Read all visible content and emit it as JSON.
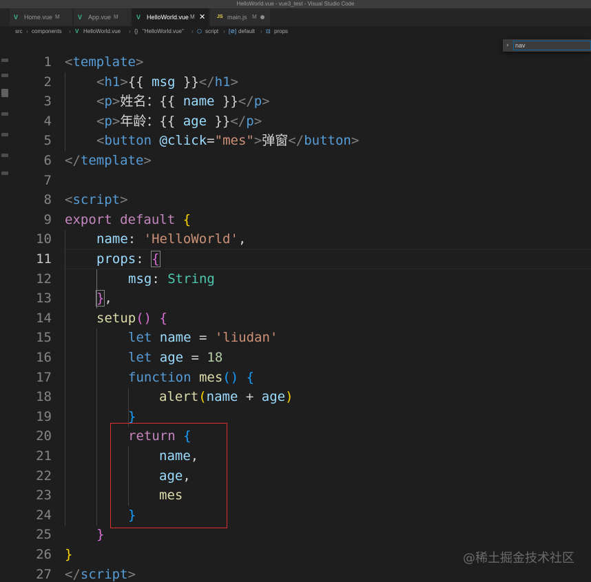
{
  "window": {
    "title": "HelloWorld.vue - vue3_test - Visual Studio Code"
  },
  "tabs": [
    {
      "icon": "V",
      "label": "Home.vue",
      "status": "M"
    },
    {
      "icon": "V",
      "label": "App.vue",
      "status": "M"
    },
    {
      "icon": "V",
      "label": "HelloWorld.vue",
      "status": "M",
      "close": "✕"
    },
    {
      "icon": "JS",
      "label": "main.js",
      "status": "M"
    }
  ],
  "breadcrumb": {
    "items": [
      "src",
      "components",
      "HelloWorld.vue",
      "\"HelloWorld.vue\"",
      "script",
      "default",
      "props"
    ],
    "separator": "›",
    "symbol_icons": [
      "V",
      "{}",
      "⬡",
      "[⊘]",
      "⊡"
    ]
  },
  "find_widget": {
    "chevron": "›",
    "value": "nav"
  },
  "editor": {
    "current_line": 11,
    "line_numbers": [
      "1",
      "2",
      "3",
      "4",
      "5",
      "6",
      "7",
      "8",
      "9",
      "10",
      "11",
      "12",
      "13",
      "14",
      "15",
      "16",
      "17",
      "18",
      "19",
      "20",
      "21",
      "22",
      "23",
      "24",
      "25",
      "26",
      "27"
    ],
    "code": {
      "l1": [
        "<",
        "template",
        ">"
      ],
      "l2": [
        "<",
        "h1",
        ">",
        "{{",
        " msg ",
        "}}",
        "</",
        "h1",
        ">"
      ],
      "l3": [
        "<",
        "p",
        ">",
        "姓名：",
        "{{",
        " name ",
        "}}",
        "</",
        "p",
        ">"
      ],
      "l4": [
        "<",
        "p",
        ">",
        "年龄：",
        "{{",
        " age ",
        "}}",
        "</",
        "p",
        ">"
      ],
      "l5": [
        "<",
        "button",
        " @click",
        "=",
        "\"mes\"",
        ">",
        "弹窗",
        "</",
        "button",
        ">"
      ],
      "l6": [
        "</",
        "template",
        ">"
      ],
      "l8": [
        "<",
        "script",
        ">"
      ],
      "l9": [
        "export",
        " default ",
        "{"
      ],
      "l10": [
        "name",
        ": ",
        "'HelloWorld'",
        ","
      ],
      "l11": [
        "props",
        ": ",
        "{"
      ],
      "l12": [
        "msg",
        ": ",
        "String"
      ],
      "l13": [
        "}",
        ","
      ],
      "l14": [
        "setup",
        "()",
        " {"
      ],
      "l15": [
        "let",
        " name",
        " = ",
        "'liudan'"
      ],
      "l16": [
        "let",
        " age",
        " = ",
        "18"
      ],
      "l17": [
        "function",
        " mes",
        "()",
        " {"
      ],
      "l18": [
        "alert",
        "(",
        "name",
        " + ",
        "age",
        ")"
      ],
      "l19": [
        "}"
      ],
      "l20": [
        "return",
        " {"
      ],
      "l21": [
        "name",
        ","
      ],
      "l22": [
        "age",
        ","
      ],
      "l23": [
        "mes"
      ],
      "l24": [
        "}"
      ],
      "l25": [
        "}"
      ],
      "l26": [
        "}"
      ],
      "l27": [
        "</",
        "script",
        ">"
      ]
    }
  },
  "highlight": {
    "color": "#e0312f"
  },
  "watermark": "@稀土掘金技术社区"
}
